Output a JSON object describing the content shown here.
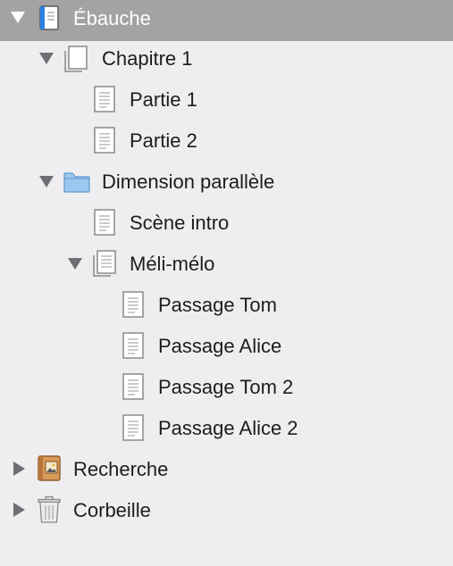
{
  "binder": {
    "draft": {
      "label": "Ébauche",
      "icon": "draft-notebook-icon"
    },
    "chapter1": {
      "label": "Chapitre 1",
      "icon": "stacked-pages-icon"
    },
    "part1": {
      "label": "Partie 1",
      "icon": "text-document-icon"
    },
    "part2": {
      "label": "Partie 2",
      "icon": "text-document-icon"
    },
    "parallel": {
      "label": "Dimension parallèle",
      "icon": "folder-icon"
    },
    "intro": {
      "label": "Scène intro",
      "icon": "text-document-icon"
    },
    "melimelo": {
      "label": "Méli-mélo",
      "icon": "stacked-text-icon"
    },
    "tom": {
      "label": "Passage Tom",
      "icon": "text-document-icon"
    },
    "alice": {
      "label": "Passage Alice",
      "icon": "text-document-icon"
    },
    "tom2": {
      "label": "Passage Tom 2",
      "icon": "text-document-icon"
    },
    "alice2": {
      "label": "Passage Alice 2",
      "icon": "text-document-icon"
    },
    "research": {
      "label": "Recherche",
      "icon": "research-book-icon"
    },
    "trash": {
      "label": "Corbeille",
      "icon": "trash-icon"
    }
  },
  "colors": {
    "sidebar_bg": "#eeeef0",
    "selection_bg": "#a3a3a5",
    "folder_blue": "#9cc8ef",
    "research_orange": "#d99a5a"
  }
}
